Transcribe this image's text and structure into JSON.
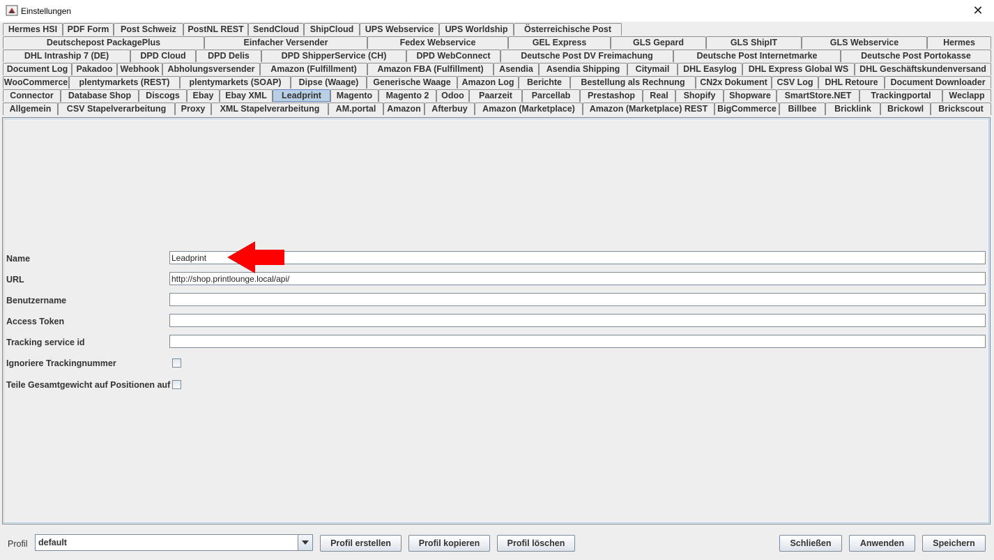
{
  "window": {
    "title": "Einstellungen",
    "close_glyph": "✕",
    "icon": "java-app-icon"
  },
  "tabs": {
    "rows": [
      [
        "Hermes HSI",
        "PDF Form",
        "Post Schweiz",
        "PostNL REST",
        "SendCloud",
        "ShipCloud",
        "UPS Webservice",
        "UPS Worldship",
        "Österreichische Post"
      ],
      [
        "Deutschepost PackagePlus",
        "Einfacher Versender",
        "Fedex Webservice",
        "GEL Express",
        "GLS Gepard",
        "GLS ShipIT",
        "GLS Webservice",
        "Hermes"
      ],
      [
        "DHL Intraship 7 (DE)",
        "DPD Cloud",
        "DPD Delis",
        "DPD ShipperService (CH)",
        "DPD WebConnect",
        "Deutsche Post DV Freimachung",
        "Deutsche Post Internetmarke",
        "Deutsche Post Portokasse"
      ],
      [
        "Document Log",
        "Pakadoo",
        "Webhook",
        "Abholungsversender",
        "Amazon (Fulfillment)",
        "Amazon FBA (Fulfillment)",
        "Asendia",
        "Asendia Shipping",
        "Citymail",
        "DHL Easylog",
        "DHL Express Global WS",
        "DHL Geschäftskundenversand"
      ],
      [
        "WooCommerce",
        "plentymarkets (REST)",
        "plentymarkets (SOAP)",
        "Dipse (Waage)",
        "Generische Waage",
        "Amazon Log",
        "Berichte",
        "Bestellung als Rechnung",
        "CN2x Dokument",
        "CSV Log",
        "DHL Retoure",
        "Document Downloader"
      ],
      [
        "Connector",
        "Database Shop",
        "Discogs",
        "Ebay",
        "Ebay XML",
        "Leadprint",
        "Magento",
        "Magento 2",
        "Odoo",
        "Paarzeit",
        "Parcellab",
        "Prestashop",
        "Real",
        "Shopify",
        "Shopware",
        "SmartStore.NET",
        "Trackingportal",
        "Weclapp"
      ],
      [
        "Allgemein",
        "CSV Stapelverarbeitung",
        "Proxy",
        "XML Stapelverarbeitung",
        "AM.portal",
        "Amazon",
        "Afterbuy",
        "Amazon (Marketplace)",
        "Amazon (Marketplace) REST",
        "BigCommerce",
        "Billbee",
        "Bricklink",
        "Brickowl",
        "Brickscout"
      ]
    ],
    "selected": "Leadprint"
  },
  "form": {
    "name_label": "Name",
    "name_value": "Leadprint",
    "url_label": "URL",
    "url_value": "http://shop.printlounge.local/api/",
    "user_label": "Benutzername",
    "user_value": "",
    "token_label": "Access Token",
    "token_value": "",
    "tracking_label": "Tracking service id",
    "tracking_value": "",
    "ignore_tracking_label": "Ignoriere Trackingnummer",
    "ignore_tracking_checked": false,
    "split_weight_label": "Teile Gesamtgewicht auf Positionen auf",
    "split_weight_checked": false
  },
  "annotation": {
    "arrow_color": "#ff0000"
  },
  "footer": {
    "profil_label": "Profil",
    "profil_value": "default",
    "create_label": "Profil erstellen",
    "copy_label": "Profil kopieren",
    "delete_label": "Profil löschen",
    "close_label": "Schließen",
    "apply_label": "Anwenden",
    "save_label": "Speichern"
  },
  "colors": {
    "selected_tab": "#b8cfe5",
    "border": "#7a8a99",
    "background": "#eeeeee"
  }
}
